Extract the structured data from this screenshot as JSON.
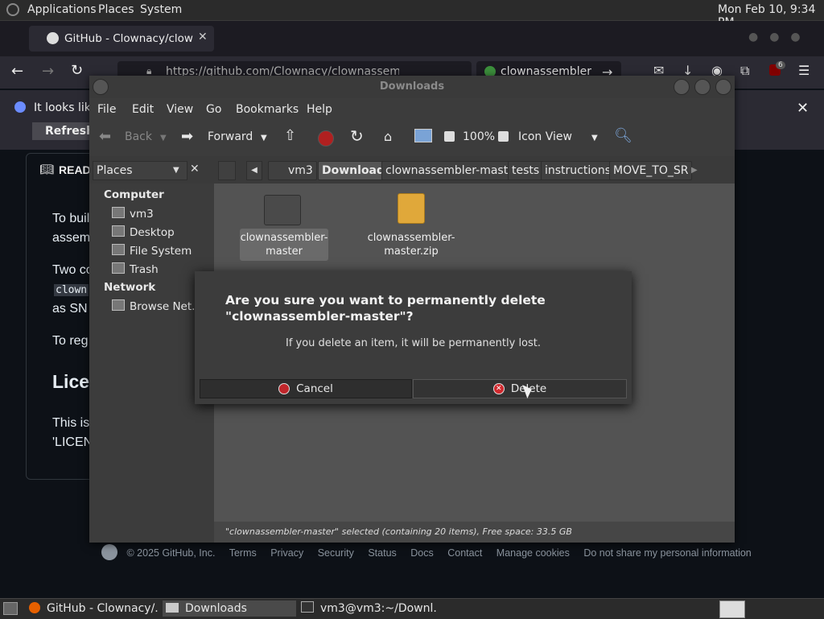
{
  "top_panel": {
    "menus": [
      "Applications",
      "Places",
      "System"
    ],
    "clock": "Mon Feb 10,  9:34 PM"
  },
  "firefox": {
    "tab_title": "GitHub - Clownacy/clownas",
    "url": "https://github.com/Clownacy/clownassembler",
    "search_text": "clownassembler",
    "badge_count": "6",
    "notice_text": "It looks like",
    "refresh_label": "Refresh F"
  },
  "github": {
    "readme_tab": "READ",
    "lines": [
      "To buil",
      "assem",
      "Two co",
      "clown",
      "as SN",
      "To reg"
    ],
    "license_heading": "Lice",
    "license_lines": [
      "This is",
      "'LICEN"
    ],
    "footer": [
      "© 2025 GitHub, Inc.",
      "Terms",
      "Privacy",
      "Security",
      "Status",
      "Docs",
      "Contact",
      "Manage cookies",
      "Do not share my personal information"
    ]
  },
  "caja": {
    "title": "Downloads",
    "menus": [
      "File",
      "Edit",
      "View",
      "Go",
      "Bookmarks",
      "Help"
    ],
    "toolbar": {
      "back": "Back",
      "forward": "Forward",
      "zoom": "100%",
      "view_mode": "Icon View"
    },
    "sidebar_mode": "Places",
    "breadcrumbs": [
      "vm3",
      "Downloads",
      "clownassembler-master",
      "tests",
      "instructions",
      "MOVE_TO_SR"
    ],
    "sidebar": {
      "computer_header": "Computer",
      "computer_items": [
        "vm3",
        "Desktop",
        "File System",
        "Trash"
      ],
      "network_header": "Network",
      "network_items": [
        "Browse Net..."
      ]
    },
    "files": [
      {
        "name1": "clownassembler-",
        "name2": "master"
      },
      {
        "name1": "clownassembler-",
        "name2": "master.zip"
      }
    ],
    "status": "\"clownassembler-master\" selected (containing 20 items), Free space: 33.5 GB"
  },
  "dialog": {
    "title": "Are you sure you want to permanently delete \"clownassembler-master\"?",
    "message": "If you delete an item, it will be permanently lost.",
    "cancel_label": "Cancel",
    "delete_label": "Delete"
  },
  "taskbar": {
    "items": [
      "GitHub - Clownacy/...",
      "Downloads",
      "vm3@vm3:~/Downl..."
    ]
  },
  "colors": {
    "cancel_icon": "#c0262b",
    "delete_icon": "#d0282d",
    "firefox_bg": "#2b2a33"
  }
}
